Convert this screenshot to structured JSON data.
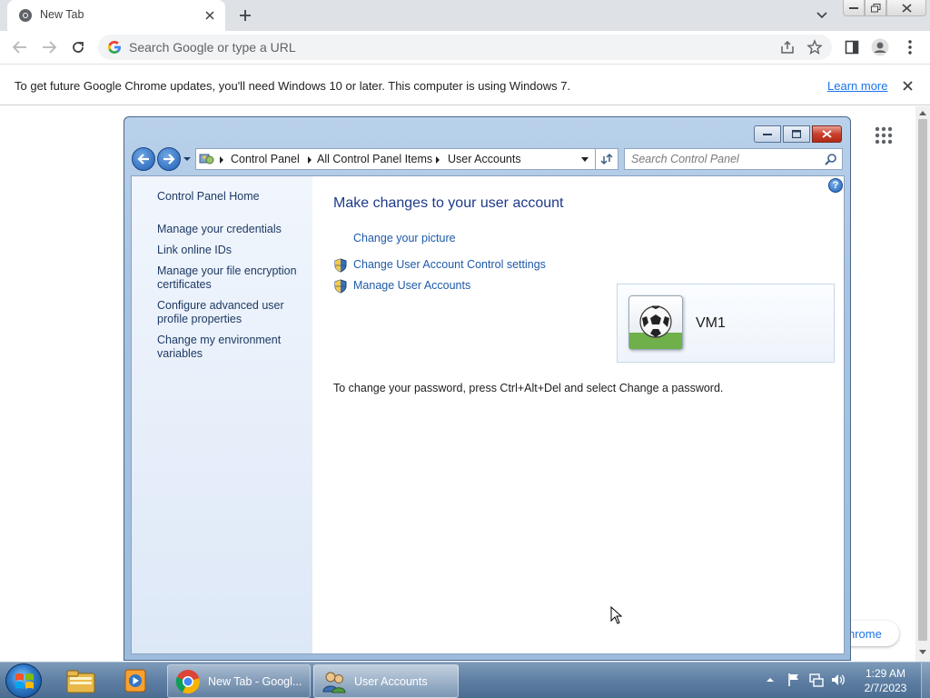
{
  "browser": {
    "tab": {
      "title": "New Tab",
      "favicon": "chrome-icon"
    },
    "omnibox": {
      "placeholder": "Search Google or type a URL"
    },
    "infobar": {
      "message": "To get future Google Chrome updates, you'll need Windows 10 or later. This computer is using Windows 7.",
      "learn_more": "Learn more"
    },
    "customize_label": "hrome"
  },
  "control_panel": {
    "breadcrumb": [
      "Control Panel",
      "All Control Panel Items",
      "User Accounts"
    ],
    "search_placeholder": "Search Control Panel",
    "help_label": "?",
    "nav": {
      "home": "Control Panel Home",
      "links": [
        {
          "label": "Manage your credentials"
        },
        {
          "label": "Link online IDs"
        },
        {
          "label": "Manage your file encryption certificates"
        },
        {
          "label": "Configure advanced user profile properties"
        },
        {
          "label": "Change my environment variables"
        }
      ]
    },
    "heading": "Make changes to your user account",
    "tasks": [
      {
        "label": "Change your picture",
        "shield": false
      },
      {
        "label": "Change User Account Control settings",
        "shield": true
      },
      {
        "label": "Manage User Accounts",
        "shield": true
      }
    ],
    "password_note": "To change your password, press Ctrl+Alt+Del and select Change a password.",
    "user": {
      "name": "VM1",
      "picture": "soccer-ball-icon"
    }
  },
  "taskbar": {
    "pinned": [
      "explorer-icon",
      "media-player-icon"
    ],
    "tasks": [
      {
        "label": "New Tab - Googl...",
        "icon": "chrome-icon"
      },
      {
        "label": "User Accounts",
        "icon": "user-accounts-icon"
      }
    ],
    "clock": {
      "time": "1:29 AM",
      "date": "2/7/2023"
    }
  }
}
